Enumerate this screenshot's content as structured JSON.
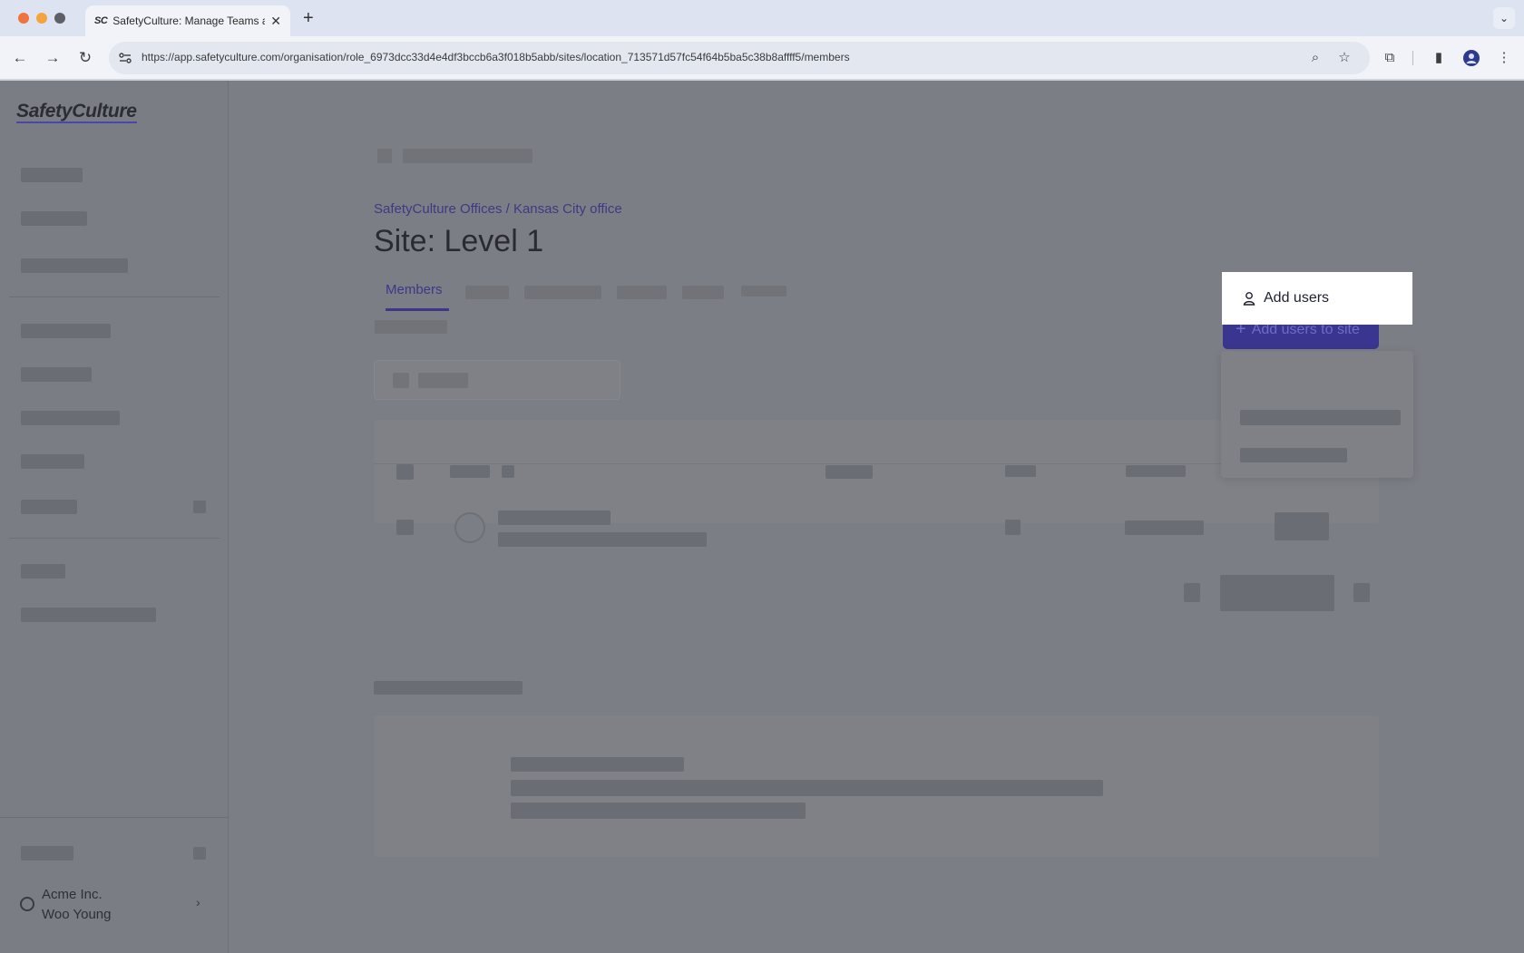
{
  "browser": {
    "tab_title": "SafetyCulture: Manage Teams and...",
    "favicon_text": "SC",
    "url": "https://app.safetyculture.com/organisation/role_6973dcc33d4e4df3bccb6a3f018b5abb/sites/location_713571d57fc54f64b5ba5c38b8affff5/members"
  },
  "sidebar": {
    "logo": "SafetyCulture",
    "org_name": "Acme Inc.",
    "user_name": "Woo Young"
  },
  "main": {
    "breadcrumb": "SafetyCulture Offices / Kansas City office",
    "title": "Site: Level 1",
    "active_tab": "Members",
    "add_button_label": "Add users to site"
  },
  "dropdown": {
    "items": [
      {
        "label": "Add users",
        "icon": "user-icon"
      }
    ]
  },
  "colors": {
    "accent": "#3b3889",
    "overlay": "#7c7e85",
    "chrome": "#dde3f1"
  }
}
